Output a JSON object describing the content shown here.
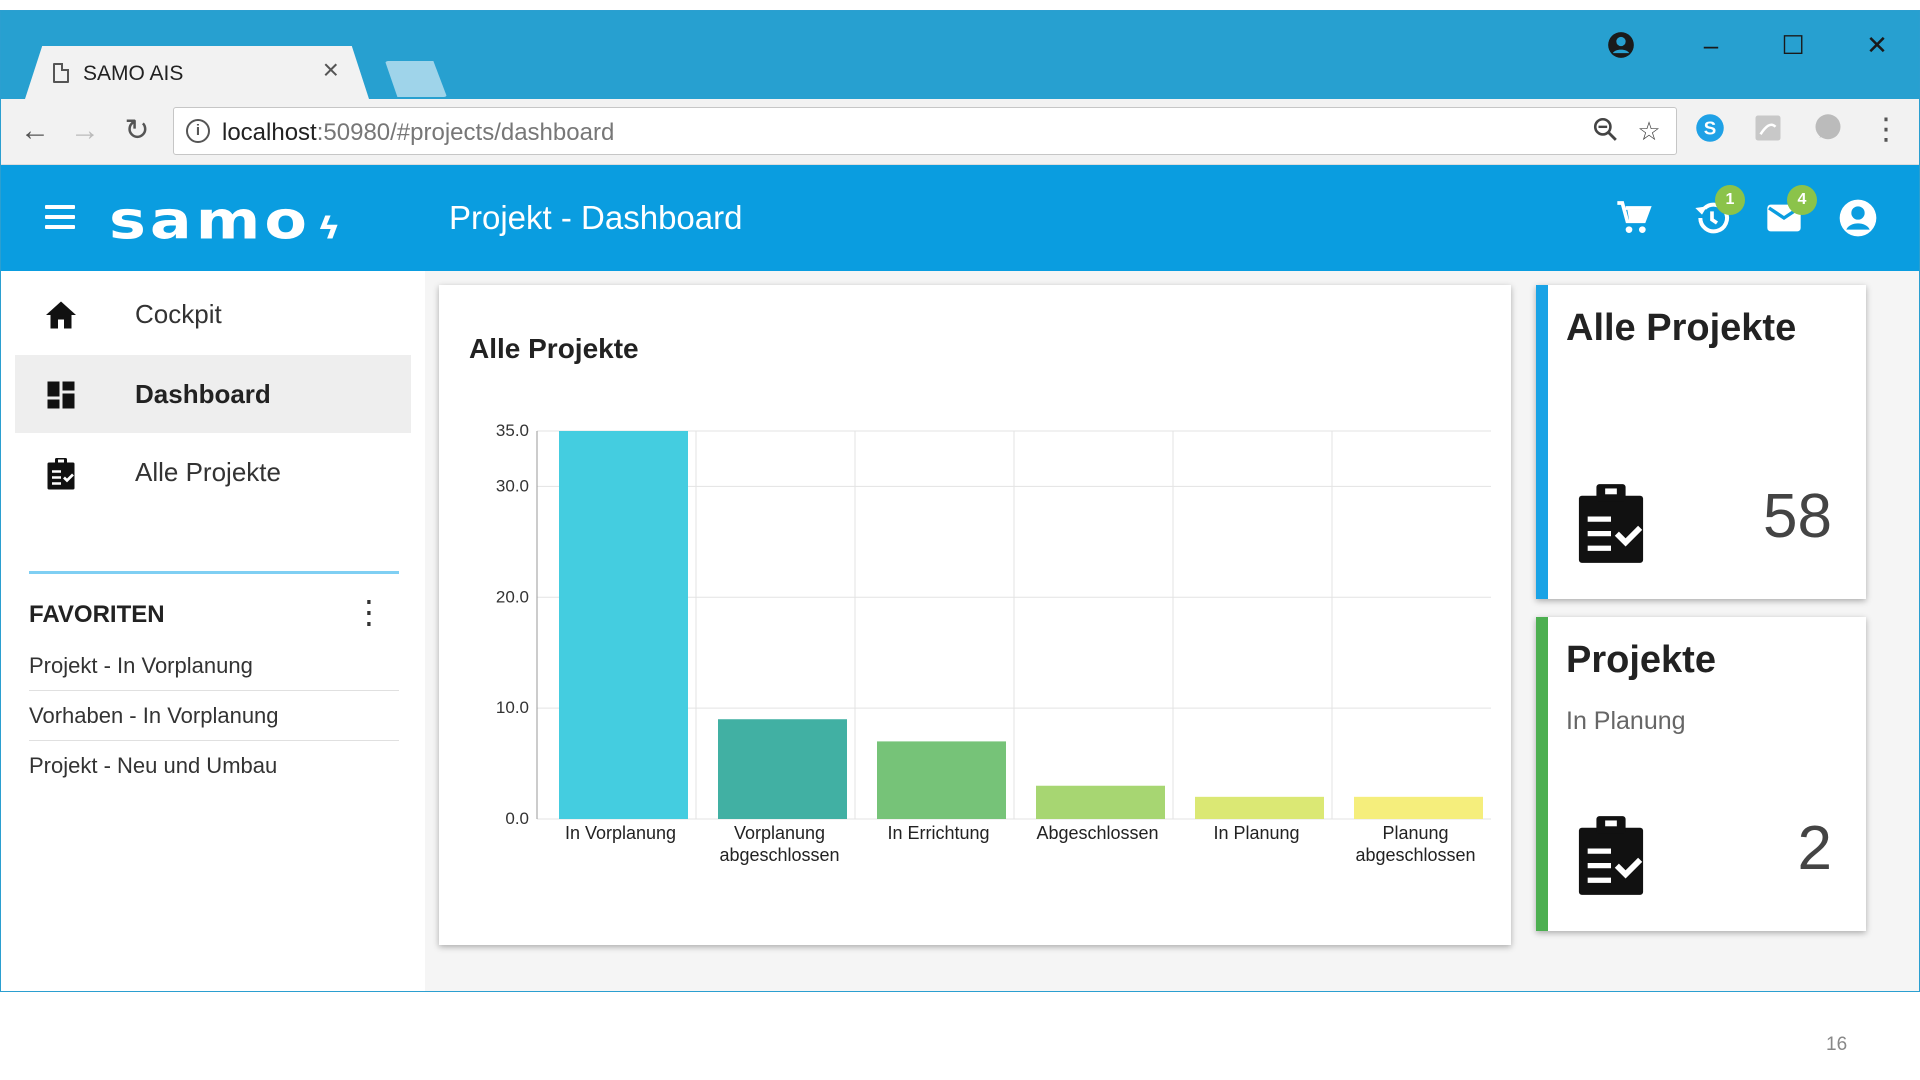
{
  "browser": {
    "tab_title": "SAMO AIS",
    "tab_close": "×",
    "url_host": "localhost",
    "url_rest": ":50980/#projects/dashboard",
    "window_controls": {
      "minimize": "–",
      "maximize": "☐",
      "close": "✕"
    }
  },
  "app": {
    "logo": "samo",
    "page_title": "Projekt - Dashboard",
    "header_icons": [
      {
        "name": "cart-icon",
        "badge": ""
      },
      {
        "name": "history-icon",
        "badge": "1"
      },
      {
        "name": "mail-icon",
        "badge": "4"
      },
      {
        "name": "account-icon",
        "badge": ""
      }
    ],
    "accent": "#0a9de0"
  },
  "sidebar": {
    "items": [
      {
        "label": "Cockpit",
        "icon": "home-icon",
        "active": false
      },
      {
        "label": "Dashboard",
        "icon": "dashboard-icon",
        "active": true
      },
      {
        "label": "Alle Projekte",
        "icon": "clipboard-icon",
        "active": false
      }
    ],
    "favorites_title": "FAVORITEN",
    "favorites": [
      "Projekt - In Vorplanung",
      "Vorhaben - In Vorplanung",
      "Projekt - Neu und Umbau"
    ]
  },
  "chart_card": {
    "title": "Alle Projekte"
  },
  "chart_data": {
    "type": "bar",
    "title": "Alle Projekte",
    "categories": [
      "In Vorplanung",
      "Vorplanung abgeschlossen",
      "In Errichtung",
      "Abgeschlossen",
      "In Planung",
      "Planung abgeschlossen"
    ],
    "category_lines": [
      [
        "In Vorplanung"
      ],
      [
        "Vorplanung",
        "abgeschlossen"
      ],
      [
        "In Errichtung"
      ],
      [
        "Abgeschlossen"
      ],
      [
        "In Planung"
      ],
      [
        "Planung",
        "abgeschlossen"
      ]
    ],
    "values": [
      35,
      9,
      7,
      3,
      2,
      2
    ],
    "colors": [
      "#44cde0",
      "#41b0a3",
      "#76c378",
      "#a7d672",
      "#dbe874",
      "#f5ee7c"
    ],
    "yticks": [
      "0.0",
      "10.0",
      "20.0",
      "30.0",
      "35.0"
    ],
    "ylim": [
      0,
      35
    ],
    "grid": true
  },
  "stat_cards": [
    {
      "title": "Alle Projekte",
      "subtitle": "",
      "value": "58",
      "color": "#19a3e6"
    },
    {
      "title": "Projekte",
      "subtitle": "In Planung",
      "value": "2",
      "color": "#4caf50"
    }
  ],
  "page_number": "16"
}
